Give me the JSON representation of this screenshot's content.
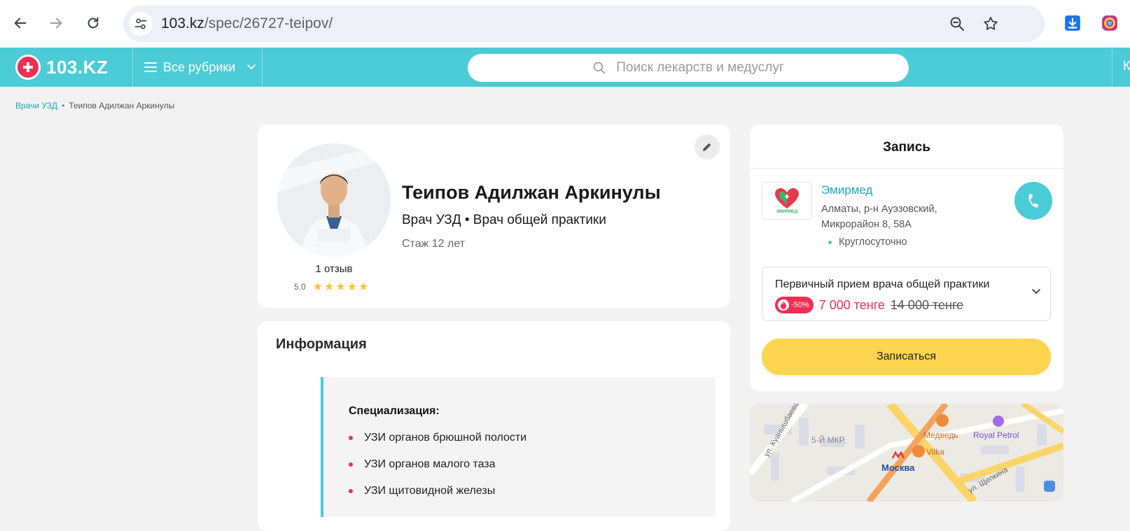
{
  "browser": {
    "url_host": "103.kz",
    "url_path": "/spec/26727-teipov/"
  },
  "header": {
    "logo_text": "103.KZ",
    "rubrics_label": "Все рубрики",
    "search_placeholder": "Поиск лекарств и медуслуг",
    "cut_text": "К"
  },
  "breadcrumb": {
    "parent": "Врачи УЗД",
    "separator": "•",
    "current": "Теипов Адилжан Аркинулы"
  },
  "profile": {
    "name": "Теипов Адилжан Аркинулы",
    "specialties": "Врач УЗД • Врач общей практики",
    "experience": "Стаж 12 лет",
    "reviews": "1 отзыв",
    "rating": "5.0",
    "stars": 5
  },
  "info": {
    "title": "Информация",
    "spec_heading": "Специализация:",
    "items": [
      "УЗИ органов брюшной полости",
      "УЗИ органов малого таза",
      "УЗИ щитовидной железы"
    ]
  },
  "booking": {
    "title": "Запись",
    "clinic_name": "Эмирмед",
    "clinic_logo_text": "ЭМИРМЕД",
    "address_line1": "Алматы, р-н Ауэзовский,",
    "address_line2": "Микрорайон 8, 58А",
    "hours": "Круглосуточно",
    "service": "Первичный прием врача общей практики",
    "discount": "-50%",
    "price_new": "7 000 тенге",
    "price_old": "14 000 тенге",
    "book_label": "Записаться"
  },
  "map": {
    "labels": {
      "street1": "ул. Куанышбаева",
      "district": "5-Й МКР.",
      "medved": "Медведь",
      "royal": "Royal Petrol",
      "vilka": "Vilka",
      "metro": "Москва",
      "street2": "ул. Щепкина"
    }
  },
  "colors": {
    "brand_teal": "#4bcbd6",
    "accent_red": "#ef2e55",
    "button_yellow": "#fdd54e",
    "link_teal": "#1ca8b7"
  }
}
